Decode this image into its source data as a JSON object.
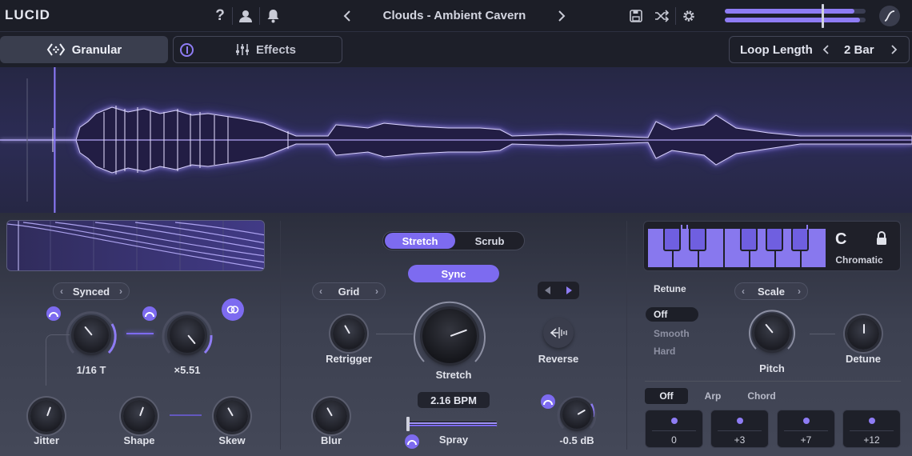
{
  "app": {
    "logo": "LUCID"
  },
  "topbar": {
    "help_label": "?",
    "preset_name": "Clouds - Ambient Cavern",
    "meter_levels": [
      0.92,
      0.96
    ]
  },
  "tabs": {
    "granular_label": "Granular",
    "effects_label": "Effects",
    "loop_length_label": "Loop Length",
    "loop_length_value": "2 Bar"
  },
  "playhead_position": 0.06,
  "lfo": {
    "mode_label": "Synced",
    "rate_value": "1/16 T",
    "depth_value": "×5.51",
    "jitter_label": "Jitter",
    "shape_label": "Shape",
    "skew_label": "Skew"
  },
  "center": {
    "mode_options": [
      "Stretch",
      "Scrub"
    ],
    "mode_selected": "Stretch",
    "sync_label": "Sync",
    "grid_label": "Grid",
    "retrigger_label": "Retrigger",
    "stretch_label": "Stretch",
    "reverse_label": "Reverse",
    "bpm_value": "2.16 BPM",
    "blur_label": "Blur",
    "spray_label": "Spray",
    "gain_value": "-0.5 dB"
  },
  "pitch": {
    "key": "C",
    "scale_name": "Chromatic",
    "retune_label": "Retune",
    "retune_options": [
      "Off",
      "Smooth",
      "Hard"
    ],
    "retune_selected": "Off",
    "scale_label": "Scale",
    "pitch_label": "Pitch",
    "detune_label": "Detune",
    "chord_modes": [
      "Off",
      "Arp",
      "Chord"
    ],
    "chord_mode_selected": "Off",
    "intervals": [
      "0",
      "+3",
      "+7",
      "+12"
    ]
  },
  "colors": {
    "accent": "#8e7cf4",
    "background": "#20222c"
  }
}
